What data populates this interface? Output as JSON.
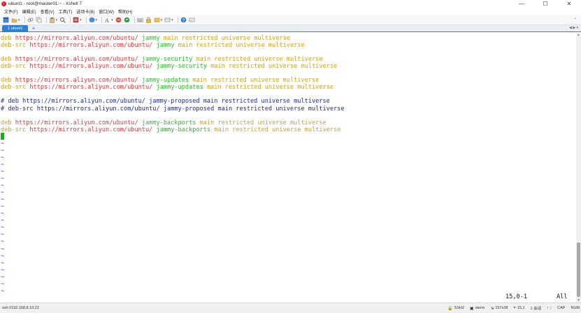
{
  "window": {
    "title": "ubunt1 - root@master01:~ - Xshell 7",
    "controls": {
      "minimize": "—",
      "maximize": "☐",
      "close": "✕"
    }
  },
  "menu": {
    "items": [
      "文件(F)",
      "编辑(E)",
      "查看(V)",
      "工具(T)",
      "选项卡(B)",
      "窗口(W)",
      "帮助(H)"
    ]
  },
  "toolbar": {
    "overflow": "⌃"
  },
  "tabs": {
    "active": "1 ubunt1",
    "add": "+",
    "nav": "◀ ▶ ▾"
  },
  "terminal": {
    "lines": [
      [
        {
          "t": "deb ",
          "c": "c-kw"
        },
        {
          "t": "https://mirrors.aliyun.com/ubuntu/",
          "c": "c-url"
        },
        {
          "t": " ",
          "c": ""
        },
        {
          "t": "jammy",
          "c": "c-suite"
        },
        {
          "t": " main restricted universe multiverse",
          "c": "c-comp"
        }
      ],
      [
        {
          "t": "deb-src ",
          "c": "c-kw"
        },
        {
          "t": "https://mirrors.aliyun.com/ubuntu/",
          "c": "c-url"
        },
        {
          "t": " ",
          "c": ""
        },
        {
          "t": "jammy",
          "c": "c-suite"
        },
        {
          "t": " main restricted universe multiverse",
          "c": "c-comp"
        }
      ],
      [],
      [
        {
          "t": "deb ",
          "c": "c-kw"
        },
        {
          "t": "https://mirrors.aliyun.com/ubuntu/",
          "c": "c-url"
        },
        {
          "t": " ",
          "c": ""
        },
        {
          "t": "jammy-security",
          "c": "c-suite"
        },
        {
          "t": " main restricted universe multiverse",
          "c": "c-comp"
        }
      ],
      [
        {
          "t": "deb-src ",
          "c": "c-kw"
        },
        {
          "t": "https://mirrors.aliyun.com/ubuntu/",
          "c": "c-url"
        },
        {
          "t": " ",
          "c": ""
        },
        {
          "t": "jammy-security",
          "c": "c-suite"
        },
        {
          "t": " main restricted universe multiverse",
          "c": "c-comp"
        }
      ],
      [],
      [
        {
          "t": "deb ",
          "c": "c-kw"
        },
        {
          "t": "https://mirrors.aliyun.com/ubuntu/",
          "c": "c-url"
        },
        {
          "t": " ",
          "c": ""
        },
        {
          "t": "jammy-updates",
          "c": "c-suite"
        },
        {
          "t": " main restricted universe multiverse",
          "c": "c-comp"
        }
      ],
      [
        {
          "t": "deb-src ",
          "c": "c-kw"
        },
        {
          "t": "https://mirrors.aliyun.com/ubuntu/",
          "c": "c-url"
        },
        {
          "t": " ",
          "c": ""
        },
        {
          "t": "jammy-updates",
          "c": "c-suite"
        },
        {
          "t": " main restricted universe multiverse",
          "c": "c-comp"
        }
      ],
      [],
      [
        {
          "t": "# deb https://mirrors.aliyun.com/ubuntu/ jammy-proposed main restricted universe multiverse",
          "c": "c-comment"
        }
      ],
      [
        {
          "t": "# deb-src https://mirrors.aliyun.com/ubuntu/ jammy-proposed main restricted universe multiverse",
          "c": "c-comment"
        }
      ],
      [],
      [
        {
          "t": "deb ",
          "c": "c-kw"
        },
        {
          "t": "https://mirrors.aliyun.com/ubuntu/",
          "c": "c-url"
        },
        {
          "t": " ",
          "c": ""
        },
        {
          "t": "jammy-backports",
          "c": "c-suite"
        },
        {
          "t": " main restricted universe multiverse",
          "c": "c-comp"
        }
      ],
      [
        {
          "t": "deb-src ",
          "c": "c-kw"
        },
        {
          "t": "https://mirrors.aliyun.com/ubuntu/",
          "c": "c-url"
        },
        {
          "t": " ",
          "c": ""
        },
        {
          "t": "jammy-backports",
          "c": "c-suite"
        },
        {
          "t": " main restricted universe multiverse",
          "c": "c-comp"
        }
      ]
    ],
    "tilde": "~",
    "position": "15,0-1",
    "scroll": "All"
  },
  "statusbar": {
    "connection": "ssh://192.168.8.10:22",
    "protocol": "SSH2",
    "terminal_type": "xterm",
    "size": "157x38",
    "cursor_pos": "15,1",
    "sessions": "1 会话",
    "caps": "CAP",
    "num": "NUM",
    "arrows": "↑ ↓"
  }
}
